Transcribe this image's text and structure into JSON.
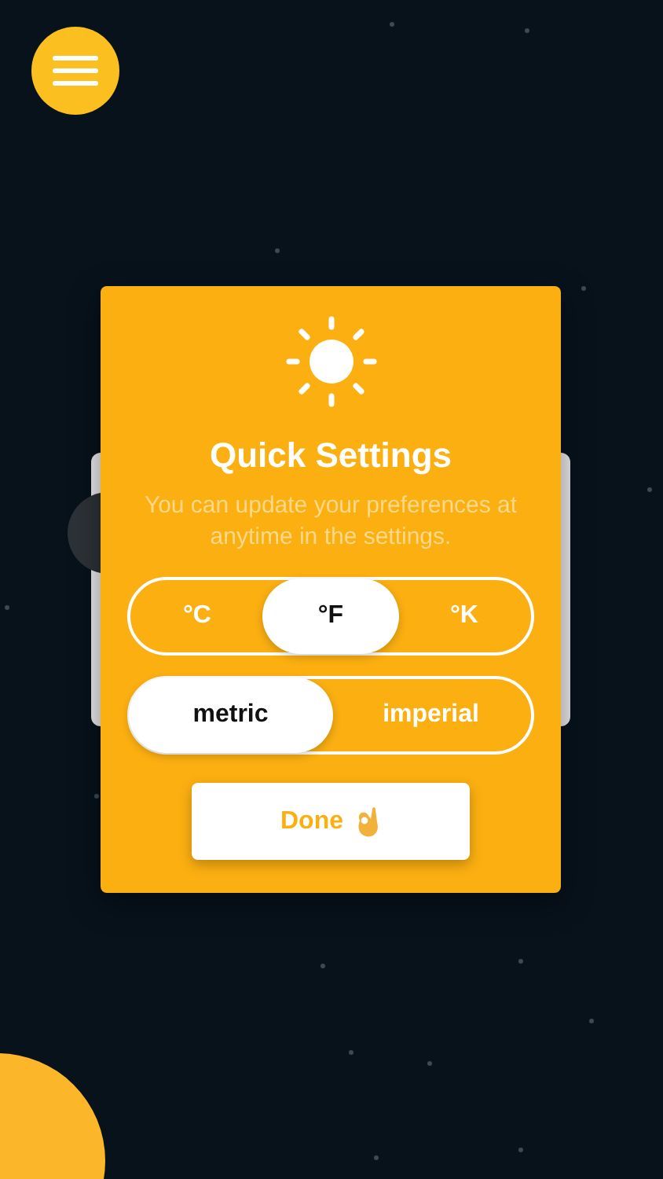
{
  "dialog": {
    "title": "Quick Settings",
    "subtitle": "You can update your preferences at anytime in the settings.",
    "segments": [
      {
        "options": [
          {
            "label": "°C",
            "selected": false
          },
          {
            "label": "°F",
            "selected": true
          },
          {
            "label": "°K",
            "selected": false
          }
        ]
      },
      {
        "options": [
          {
            "label": "metric",
            "selected": true
          },
          {
            "label": "imperial",
            "selected": false
          }
        ]
      }
    ],
    "done_button": {
      "label": "Done"
    }
  }
}
